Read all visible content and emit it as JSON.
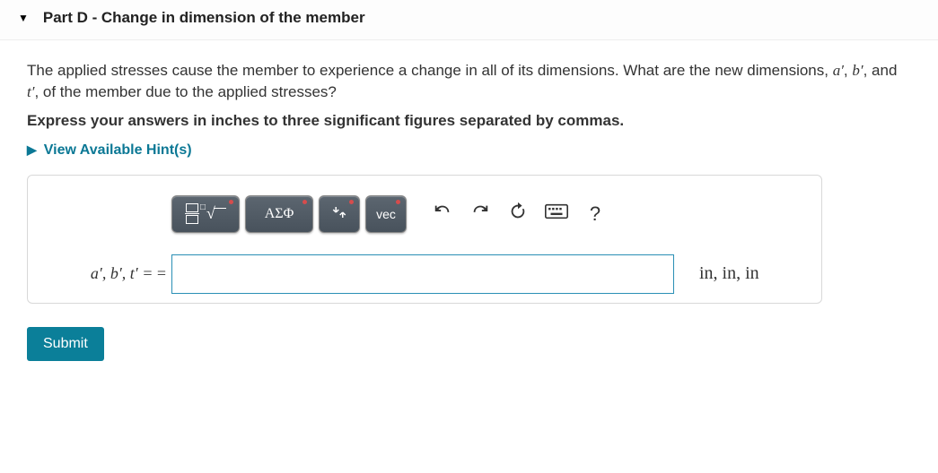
{
  "header": {
    "part_label": "Part D -",
    "part_title": "Change in dimension of the member"
  },
  "prompt_prefix": "The applied stresses cause the member to experience a change in all of its dimensions. What are the new dimensions, ",
  "prompt_vars": [
    "a′",
    "b′",
    "t′"
  ],
  "prompt_suffix": ", of the member due to the applied stresses?",
  "instruction": "Express your answers in inches to three significant figures separated by commas.",
  "hint_label": "View Available Hint(s)",
  "toolbar": {
    "fraction": "fraction",
    "root": "root",
    "greek": "ΑΣΦ",
    "subsup": "sub-sup",
    "vec": "vec",
    "undo": "undo",
    "redo": "redo",
    "reset": "reset",
    "keyboard": "keyboard",
    "help": "?"
  },
  "lhs": "a′, b′, t′  =",
  "lhs_extra": "=",
  "input_value": "",
  "units": "in,  in,  in",
  "submit": "Submit"
}
